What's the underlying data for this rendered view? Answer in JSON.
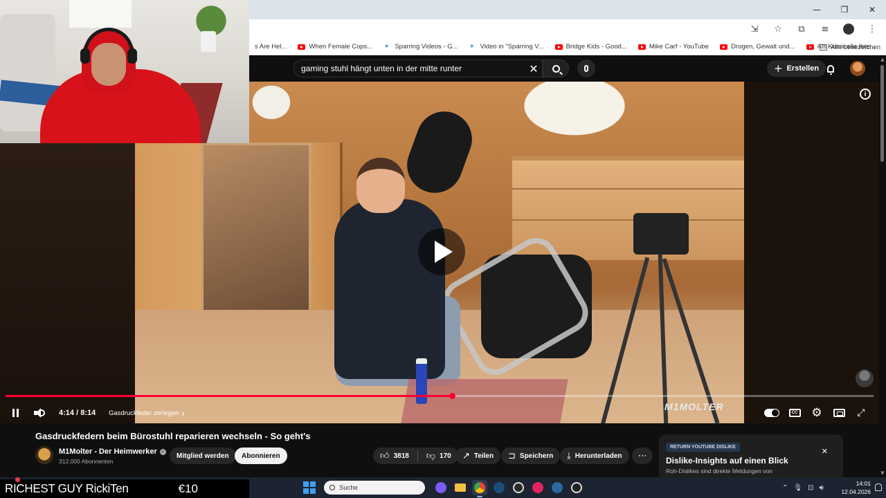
{
  "browser": {
    "window_controls": [
      "—",
      "❐",
      "✕"
    ],
    "bookmarks": [
      {
        "label": "s Are Hel...",
        "icon": "none"
      },
      {
        "label": "When Female Cops...",
        "icon": "youtube-icon"
      },
      {
        "label": "Sparring Videos - G...",
        "icon": "google-icon"
      },
      {
        "label": "Video in \"Sparring V...",
        "icon": "google-icon"
      },
      {
        "label": "Bridge Kids - Good...",
        "icon": "youtube-icon"
      },
      {
        "label": "Mike Carf - YouTube",
        "icon": "youtube-icon"
      },
      {
        "label": "Drogen, Gewalt und...",
        "icon": "youtube-icon"
      },
      {
        "label": "Als Kriminelle ihre...",
        "icon": "youtube-icon"
      }
    ],
    "bookmarks_more": "»",
    "all_bookmarks": "Alle Lesezeichen"
  },
  "masthead": {
    "search_query": "gaming stuhl hängt unten in der mitte runter",
    "create_label": "Erstellen"
  },
  "player": {
    "current_time": "4:14",
    "duration": "8:14",
    "time_separator": " / ",
    "chapter": "Gasdruckfeder zerlegen",
    "chapter_arrow": "›",
    "progress": 0.514,
    "watermark": "M1MOLTER"
  },
  "video": {
    "title": "Gasdruckfedern beim Bürostuhl reparieren wechseln - So geht's",
    "channel_name": "M1Molter - Der Heimwerker",
    "subscribers": "312.000 Abonnenten",
    "member_button": "Mitglied werden",
    "subscribe_button": "Abonnieren",
    "likes": "3818",
    "dislikes": "170",
    "share": "Teilen",
    "save": "Speichern",
    "download": "Herunterladen"
  },
  "dislike_card": {
    "badge": "RETURN YOUTUBE DISLIKE",
    "title": "Dislike-Insights auf einen Blick",
    "subtitle": "Roh-Dislikes sind direkte Meldungen von"
  },
  "taskbar": {
    "search_placeholder": "Suche",
    "clock_time": "14:01",
    "clock_date": "12.04.2026"
  },
  "ticker": {
    "name": "RICHEST GUY RickiTen",
    "amount": "€10"
  }
}
